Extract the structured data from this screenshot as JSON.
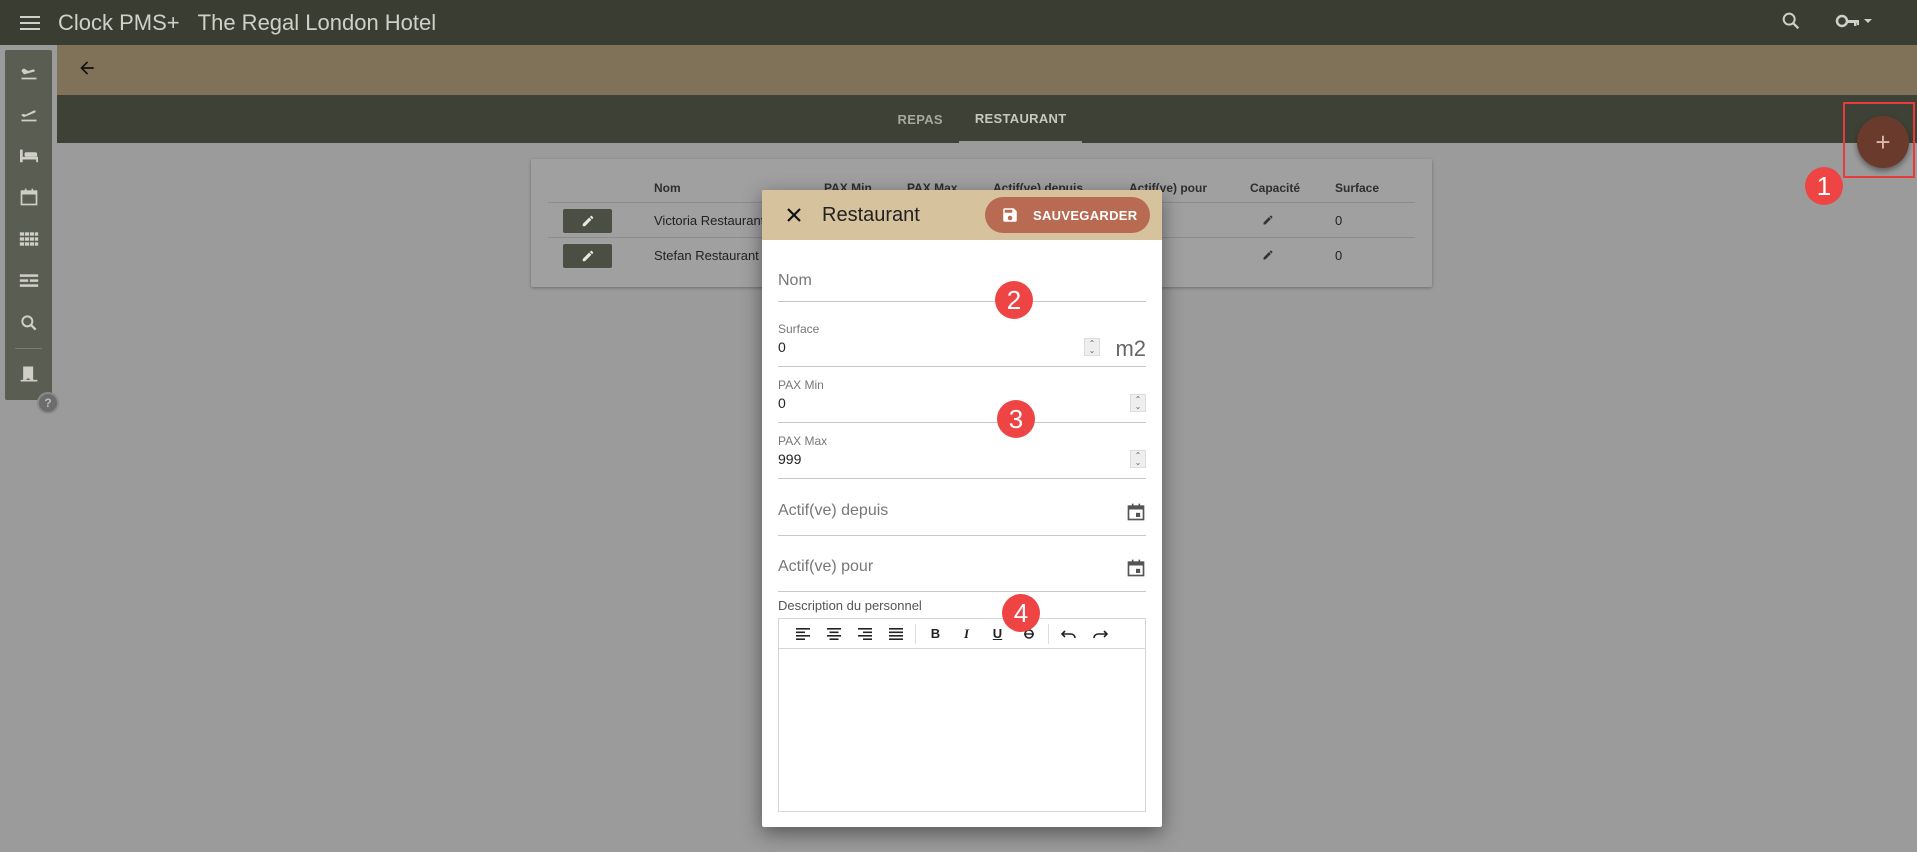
{
  "app": {
    "title": "Clock PMS+",
    "hotel": "The Regal London Hotel"
  },
  "icons": {
    "menu": "menu-icon",
    "search": "search-icon",
    "key": "key-icon",
    "back": "arrow-back-icon"
  },
  "sidebar": {
    "items": [
      "arrival-icon",
      "departure-icon",
      "bed-icon",
      "calendar-icon",
      "grid-icon",
      "rate-icon",
      "search-icon",
      "bookmark-icon"
    ],
    "help": "?"
  },
  "tabs": [
    {
      "label": "REPAS",
      "active": false
    },
    {
      "label": "RESTAURANT",
      "active": true
    }
  ],
  "fab": {
    "label": "+"
  },
  "table": {
    "headers": [
      "Nom",
      "PAX Min",
      "PAX Max",
      "Actif(ve) depuis",
      "Actif(ve) pour",
      "Capacité",
      "Surface"
    ],
    "rows": [
      {
        "name": "Victoria Restaurant",
        "surface": "0"
      },
      {
        "name": "Stefan Restaurant",
        "surface": "0"
      }
    ]
  },
  "dialog": {
    "title": "Restaurant",
    "save_label": "SAUVEGARDER",
    "fields": {
      "nom": {
        "placeholder": "Nom"
      },
      "surface": {
        "label": "Surface",
        "value": "0",
        "unit": "m2"
      },
      "pax_min": {
        "label": "PAX Min",
        "value": "0"
      },
      "pax_max": {
        "label": "PAX Max",
        "value": "999"
      },
      "actif_depuis": {
        "placeholder": "Actif(ve) depuis"
      },
      "actif_pour": {
        "placeholder": "Actif(ve) pour"
      }
    },
    "description_label": "Description du personnel",
    "toolbar": {
      "bold": "B",
      "italic": "I",
      "underline": "U"
    }
  },
  "markers": [
    "1",
    "2",
    "3",
    "4"
  ],
  "colors": {
    "topbar": "#3a3e32",
    "band": "#7f7258",
    "fab": "#6a3a2c",
    "save": "#b86a52",
    "marker": "#ee4444"
  }
}
